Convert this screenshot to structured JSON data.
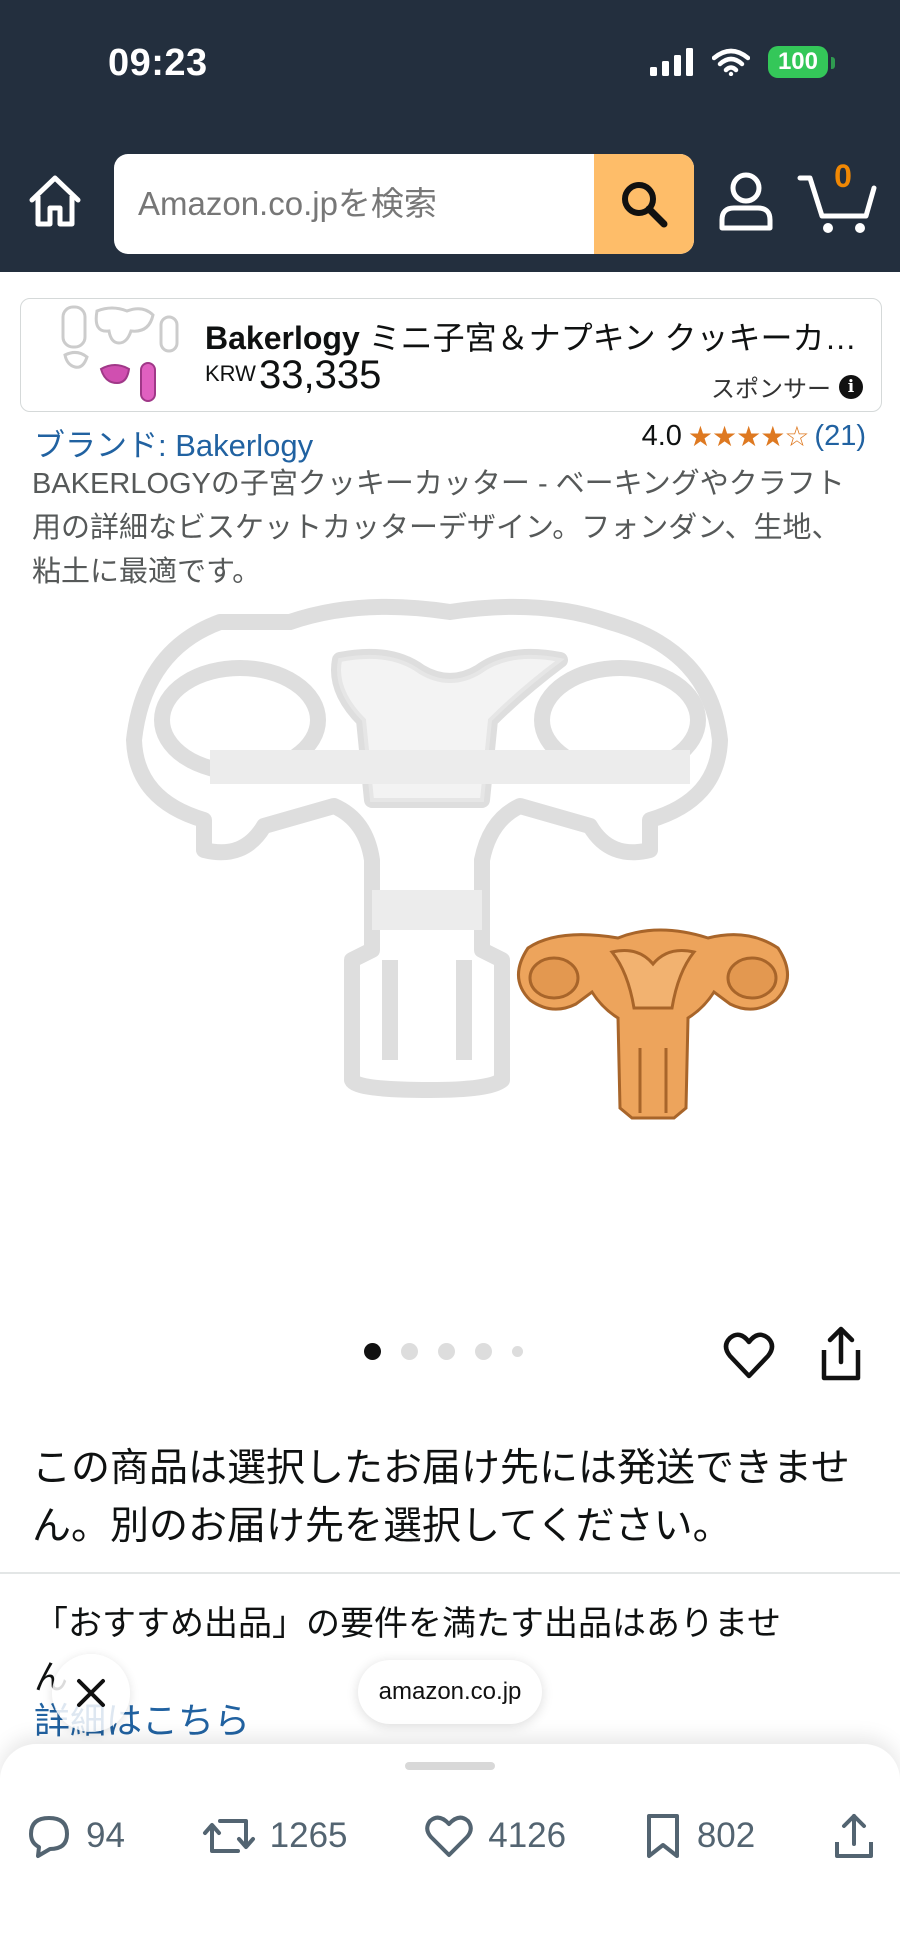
{
  "status_bar": {
    "time": "09:23",
    "battery": "100"
  },
  "header": {
    "search_placeholder": "Amazon.co.jpを検索",
    "cart_count": "0",
    "colors": {
      "background": "#232f3e",
      "search_button": "#febd69",
      "cart_count": "#f08804"
    },
    "icons": [
      "home-icon",
      "search-icon",
      "account-icon",
      "cart-icon"
    ]
  },
  "sponsored_ad": {
    "brand": "Bakerlogy",
    "title_rest": " ミニ子宮＆ナプキン クッキーカッター",
    "currency": "KRW",
    "price": "33,335",
    "sponsored_label": "スポンサー"
  },
  "product": {
    "brand_link": "ブランド: Bakerlogy",
    "rating_value": "4.0",
    "rating": 4.0,
    "stars": "★★★★☆",
    "rating_count": "(21)",
    "title": "BAKERLOGYの子宮クッキーカッター - ベーキングやクラフト用の詳細なビスケットカッターデザイン。フォンダン、生地、粘土に最適です。"
  },
  "carousel": {
    "total_dots": 5,
    "active_index": 0
  },
  "shipping_message": "この商品は選択したお届け先には発送できません。別のお届け先を選択してください。",
  "featured_offer": {
    "line1": "「おすすめ出品」の要件を満たす出品はありませ",
    "line2": "ん",
    "details_link": "詳細はこちら"
  },
  "browser": {
    "url": "amazon.co.jp"
  },
  "social_bar": {
    "replies": "94",
    "reposts": "1265",
    "likes": "4126",
    "bookmarks": "802"
  }
}
